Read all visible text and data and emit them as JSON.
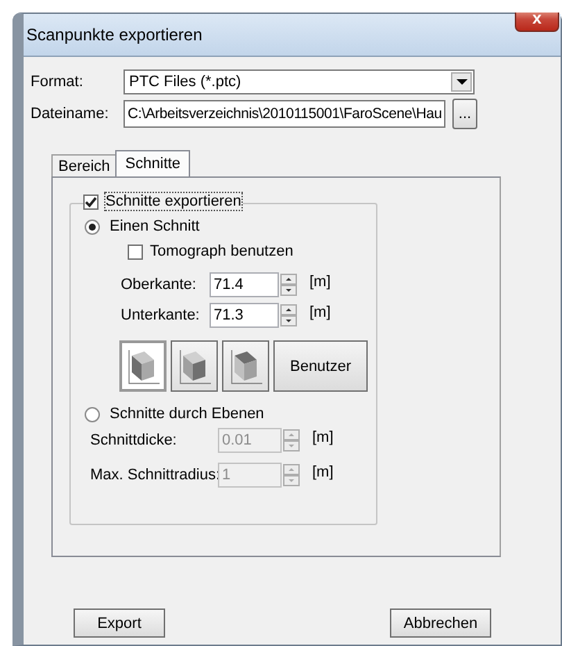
{
  "window": {
    "title": "Scanpunkte exportieren",
    "close": "x"
  },
  "format": {
    "label": "Format:",
    "value": "PTC Files (*.ptc)"
  },
  "filename": {
    "label": "Dateiname:",
    "value": "C:\\Arbeitsverzeichnis\\2010115001\\FaroScene\\Hau",
    "browse": "..."
  },
  "tabs": [
    {
      "label": "Bereich",
      "selected": false
    },
    {
      "label": "Schnitte",
      "selected": true
    }
  ],
  "group": {
    "label": "Schnitte exportieren",
    "checked": true
  },
  "modes": [
    {
      "label": "Einen Schnitt",
      "selected": true
    },
    {
      "label": "Schnitte durch Ebenen",
      "selected": false
    }
  ],
  "tomograph": {
    "label": "Tomograph benutzen",
    "checked": false
  },
  "single_fields": [
    {
      "label": "Oberkante:",
      "value": "71.4",
      "unit": "[m]",
      "disabled": false
    },
    {
      "label": "Unterkante:",
      "value": "71.3",
      "unit": "[m]",
      "disabled": false
    }
  ],
  "view_buttons": [
    {
      "selected": true
    },
    {
      "selected": false
    },
    {
      "selected": false
    }
  ],
  "custom_button": "Benutzer",
  "plane_fields": [
    {
      "label": "Schnittdicke:",
      "value": "0.01",
      "unit": "[m]",
      "disabled": true
    },
    {
      "label": "Max. Schnittradius:",
      "value": "1",
      "unit": "[m]",
      "disabled": true
    }
  ],
  "buttons": [
    {
      "label": "Export"
    },
    {
      "label": "Abbrechen"
    }
  ]
}
